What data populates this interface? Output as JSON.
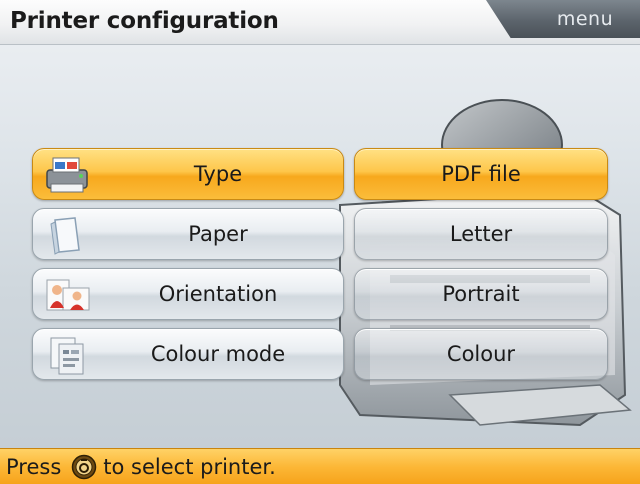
{
  "header": {
    "title": "Printer configuration",
    "menu_label": "menu"
  },
  "rows": [
    {
      "setting_label": "Type",
      "value": "PDF file",
      "icon": "printer-icon",
      "selected": true
    },
    {
      "setting_label": "Paper",
      "value": "Letter",
      "icon": "paper-icon",
      "selected": false
    },
    {
      "setting_label": "Orientation",
      "value": "Portrait",
      "icon": "orientation-icon",
      "selected": false
    },
    {
      "setting_label": "Colour mode",
      "value": "Colour",
      "icon": "colour-mode-icon",
      "selected": false
    }
  ],
  "status": {
    "prefix": "Press",
    "key_icon": "select-key-icon",
    "suffix": "to select printer."
  },
  "colors": {
    "accent": "#fcb736",
    "button": "#e3e8ec",
    "background": "#dfe5ea"
  }
}
